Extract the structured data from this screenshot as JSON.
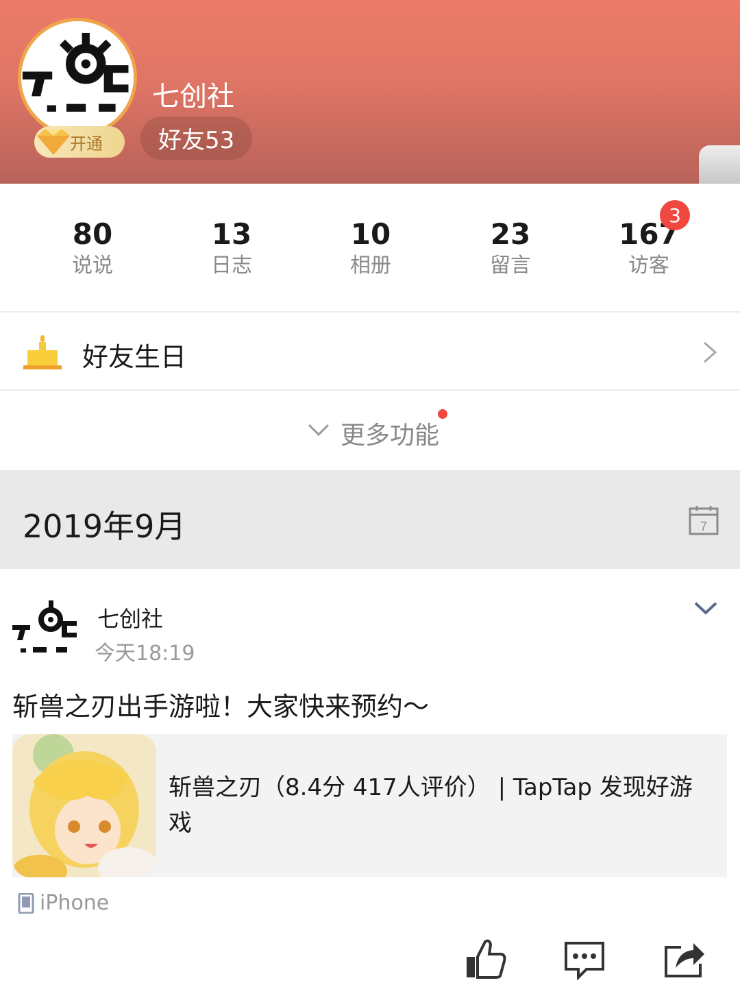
{
  "profile": {
    "name": "七创社",
    "friends": "好友53",
    "vip_label": "开通",
    "avatar_text": "7DC 七创社"
  },
  "stats": [
    {
      "value": "80",
      "label": "说说"
    },
    {
      "value": "13",
      "label": "日志"
    },
    {
      "value": "10",
      "label": "相册"
    },
    {
      "value": "23",
      "label": "留言"
    },
    {
      "value": "167",
      "label": "访客",
      "badge": "3"
    }
  ],
  "birthday": {
    "label": "好友生日"
  },
  "more": {
    "label": "更多功能"
  },
  "date_bar": {
    "label": "2019年9月",
    "calendar_day": "7"
  },
  "post": {
    "author": "七创社",
    "time": "今天18:19",
    "text": "斩兽之刃出手游啦！大家快来预约～",
    "link_title": "斩兽之刃（8.4分 417人评价） | TapTap 发现好游戏",
    "device": "iPhone"
  },
  "colors": {
    "header_top": "#ec7c69",
    "header_bottom": "#b8625a",
    "badge_red": "#f0483e",
    "vip_gold": "#efd68f"
  },
  "icons": [
    "diamond-icon",
    "cake-icon",
    "chevron-right-icon",
    "chevron-down-icon",
    "calendar-icon",
    "phone-icon",
    "like-icon",
    "comment-icon",
    "share-icon"
  ]
}
